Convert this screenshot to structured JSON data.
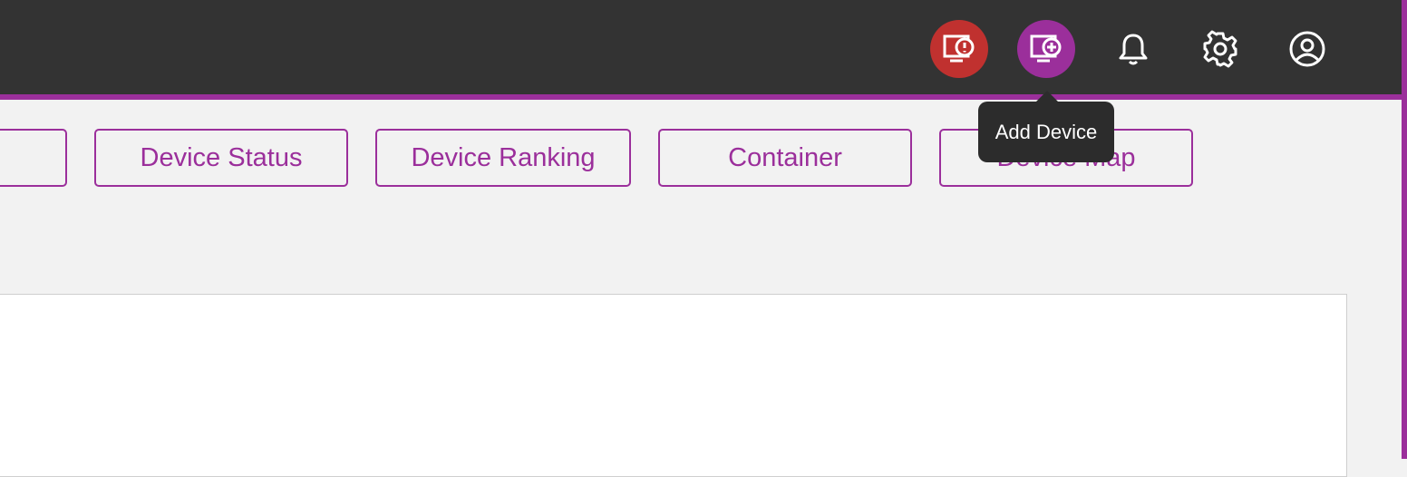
{
  "header": {
    "icons": [
      {
        "name": "device-alert-icon",
        "color": "#c0312f"
      },
      {
        "name": "add-device-icon",
        "color": "#9b2f9b"
      },
      {
        "name": "bell-icon"
      },
      {
        "name": "gear-icon"
      },
      {
        "name": "user-icon"
      }
    ],
    "tooltip": "Add Device"
  },
  "nav": {
    "tabs": [
      {
        "label": ""
      },
      {
        "label": "Device Status"
      },
      {
        "label": "Device Ranking"
      },
      {
        "label": "Container"
      },
      {
        "label": "Device Map"
      }
    ]
  },
  "colors": {
    "accent": "#9b2f9b",
    "alert": "#c0312f",
    "topbar": "#333333",
    "background": "#f2f2f2"
  }
}
